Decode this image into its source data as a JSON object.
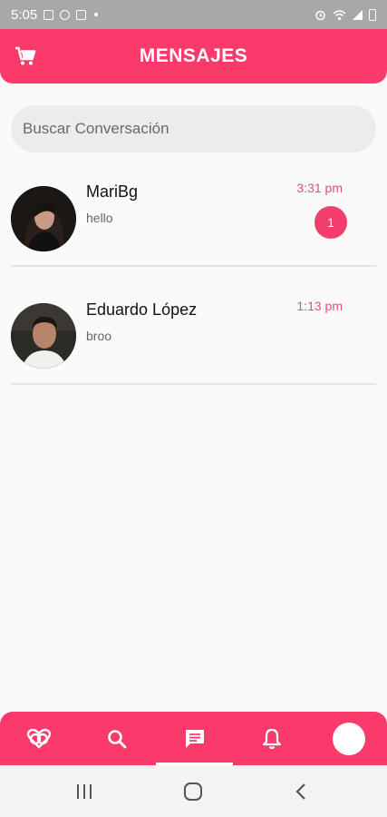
{
  "status_bar": {
    "time": "5:05",
    "left_icons": [
      "image-icon",
      "whatsapp-icon",
      "app-icon",
      "dot-icon"
    ],
    "right_icons": [
      "alarm-icon",
      "wifi-icon",
      "signal-icon",
      "battery-icon"
    ]
  },
  "header": {
    "title": "MENSAJES",
    "cart_icon": "cart-icon"
  },
  "search": {
    "placeholder": "Buscar Conversación"
  },
  "conversations": [
    {
      "name": "MariBg",
      "last_message": "hello",
      "time": "3:31 pm",
      "unread": "1"
    },
    {
      "name": "Eduardo López",
      "last_message": "broo",
      "time": "1:13 pm",
      "unread": ""
    }
  ],
  "bottom_nav": {
    "items": [
      "matches-icon",
      "search-icon",
      "chat-icon",
      "bell-icon",
      "profile-avatar"
    ],
    "active": "chat-icon"
  },
  "system_nav": {
    "items": [
      "recents-icon",
      "home-icon",
      "back-icon"
    ]
  },
  "colors": {
    "primary": "#fb3a6c",
    "accent_text": "#e0507a",
    "status_bar": "#a8a8a8",
    "background": "#fafafa"
  }
}
